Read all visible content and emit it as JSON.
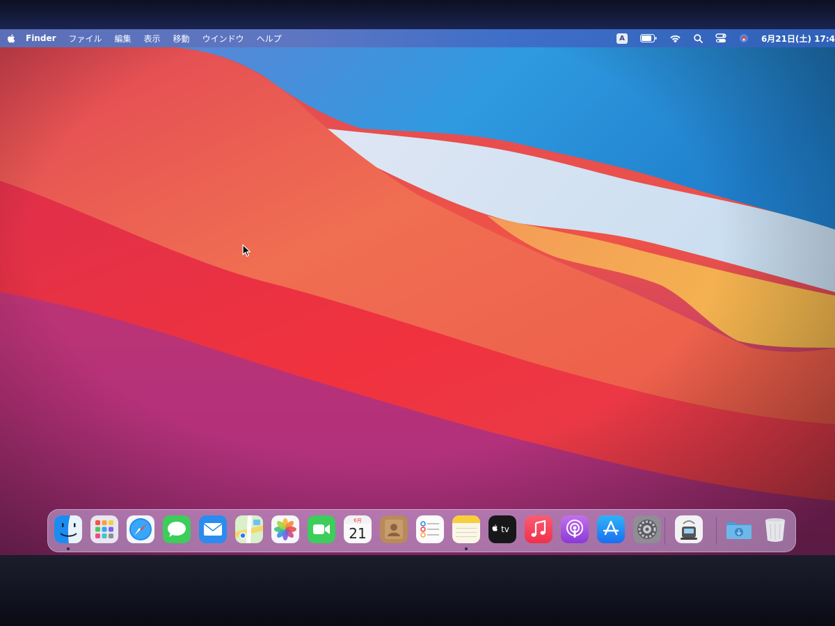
{
  "menubar": {
    "app_name": "Finder",
    "menus": [
      "ファイル",
      "編集",
      "表示",
      "移動",
      "ウインドウ",
      "ヘルプ"
    ],
    "ime_label": "A",
    "clock": "6月21日(土) 17:4"
  },
  "dock": {
    "apps": [
      {
        "name": "Finder",
        "icon": "finder-icon",
        "running": true
      },
      {
        "name": "Launchpad",
        "icon": "launchpad-icon",
        "running": false
      },
      {
        "name": "Safari",
        "icon": "safari-icon",
        "running": false
      },
      {
        "name": "Messages",
        "icon": "messages-icon",
        "running": false
      },
      {
        "name": "Mail",
        "icon": "mail-icon",
        "running": false
      },
      {
        "name": "Maps",
        "icon": "maps-icon",
        "running": false
      },
      {
        "name": "Photos",
        "icon": "photos-icon",
        "running": false
      },
      {
        "name": "FaceTime",
        "icon": "facetime-icon",
        "running": false
      },
      {
        "name": "Calendar",
        "icon": "calendar-icon",
        "running": false
      },
      {
        "name": "Contacts",
        "icon": "contacts-icon",
        "running": false
      },
      {
        "name": "Reminders",
        "icon": "reminders-icon",
        "running": false
      },
      {
        "name": "Notes",
        "icon": "notes-icon",
        "running": true
      },
      {
        "name": "TV",
        "icon": "tv-icon",
        "running": false
      },
      {
        "name": "Music",
        "icon": "music-icon",
        "running": false
      },
      {
        "name": "Podcasts",
        "icon": "podcasts-icon",
        "running": false
      },
      {
        "name": "App Store",
        "icon": "app-store-icon",
        "running": false
      },
      {
        "name": "System Preferences",
        "icon": "system-preferences-icon",
        "running": false
      },
      {
        "name": "Migration Assistant",
        "icon": "migration-assistant-icon",
        "running": false
      },
      {
        "name": "Downloads",
        "icon": "downloads-folder-icon",
        "running": false
      },
      {
        "name": "Trash",
        "icon": "trash-icon",
        "running": false
      }
    ],
    "calendar_month": "6月",
    "calendar_day": "21",
    "tv_label": "tv"
  },
  "colors": {
    "menubar": "#5e76c2",
    "wallpaper_red": "#ef3a3f",
    "wallpaper_orange": "#f07a4a",
    "wallpaper_blue": "#2f8fd8",
    "wallpaper_yellow": "#f2b04a"
  }
}
